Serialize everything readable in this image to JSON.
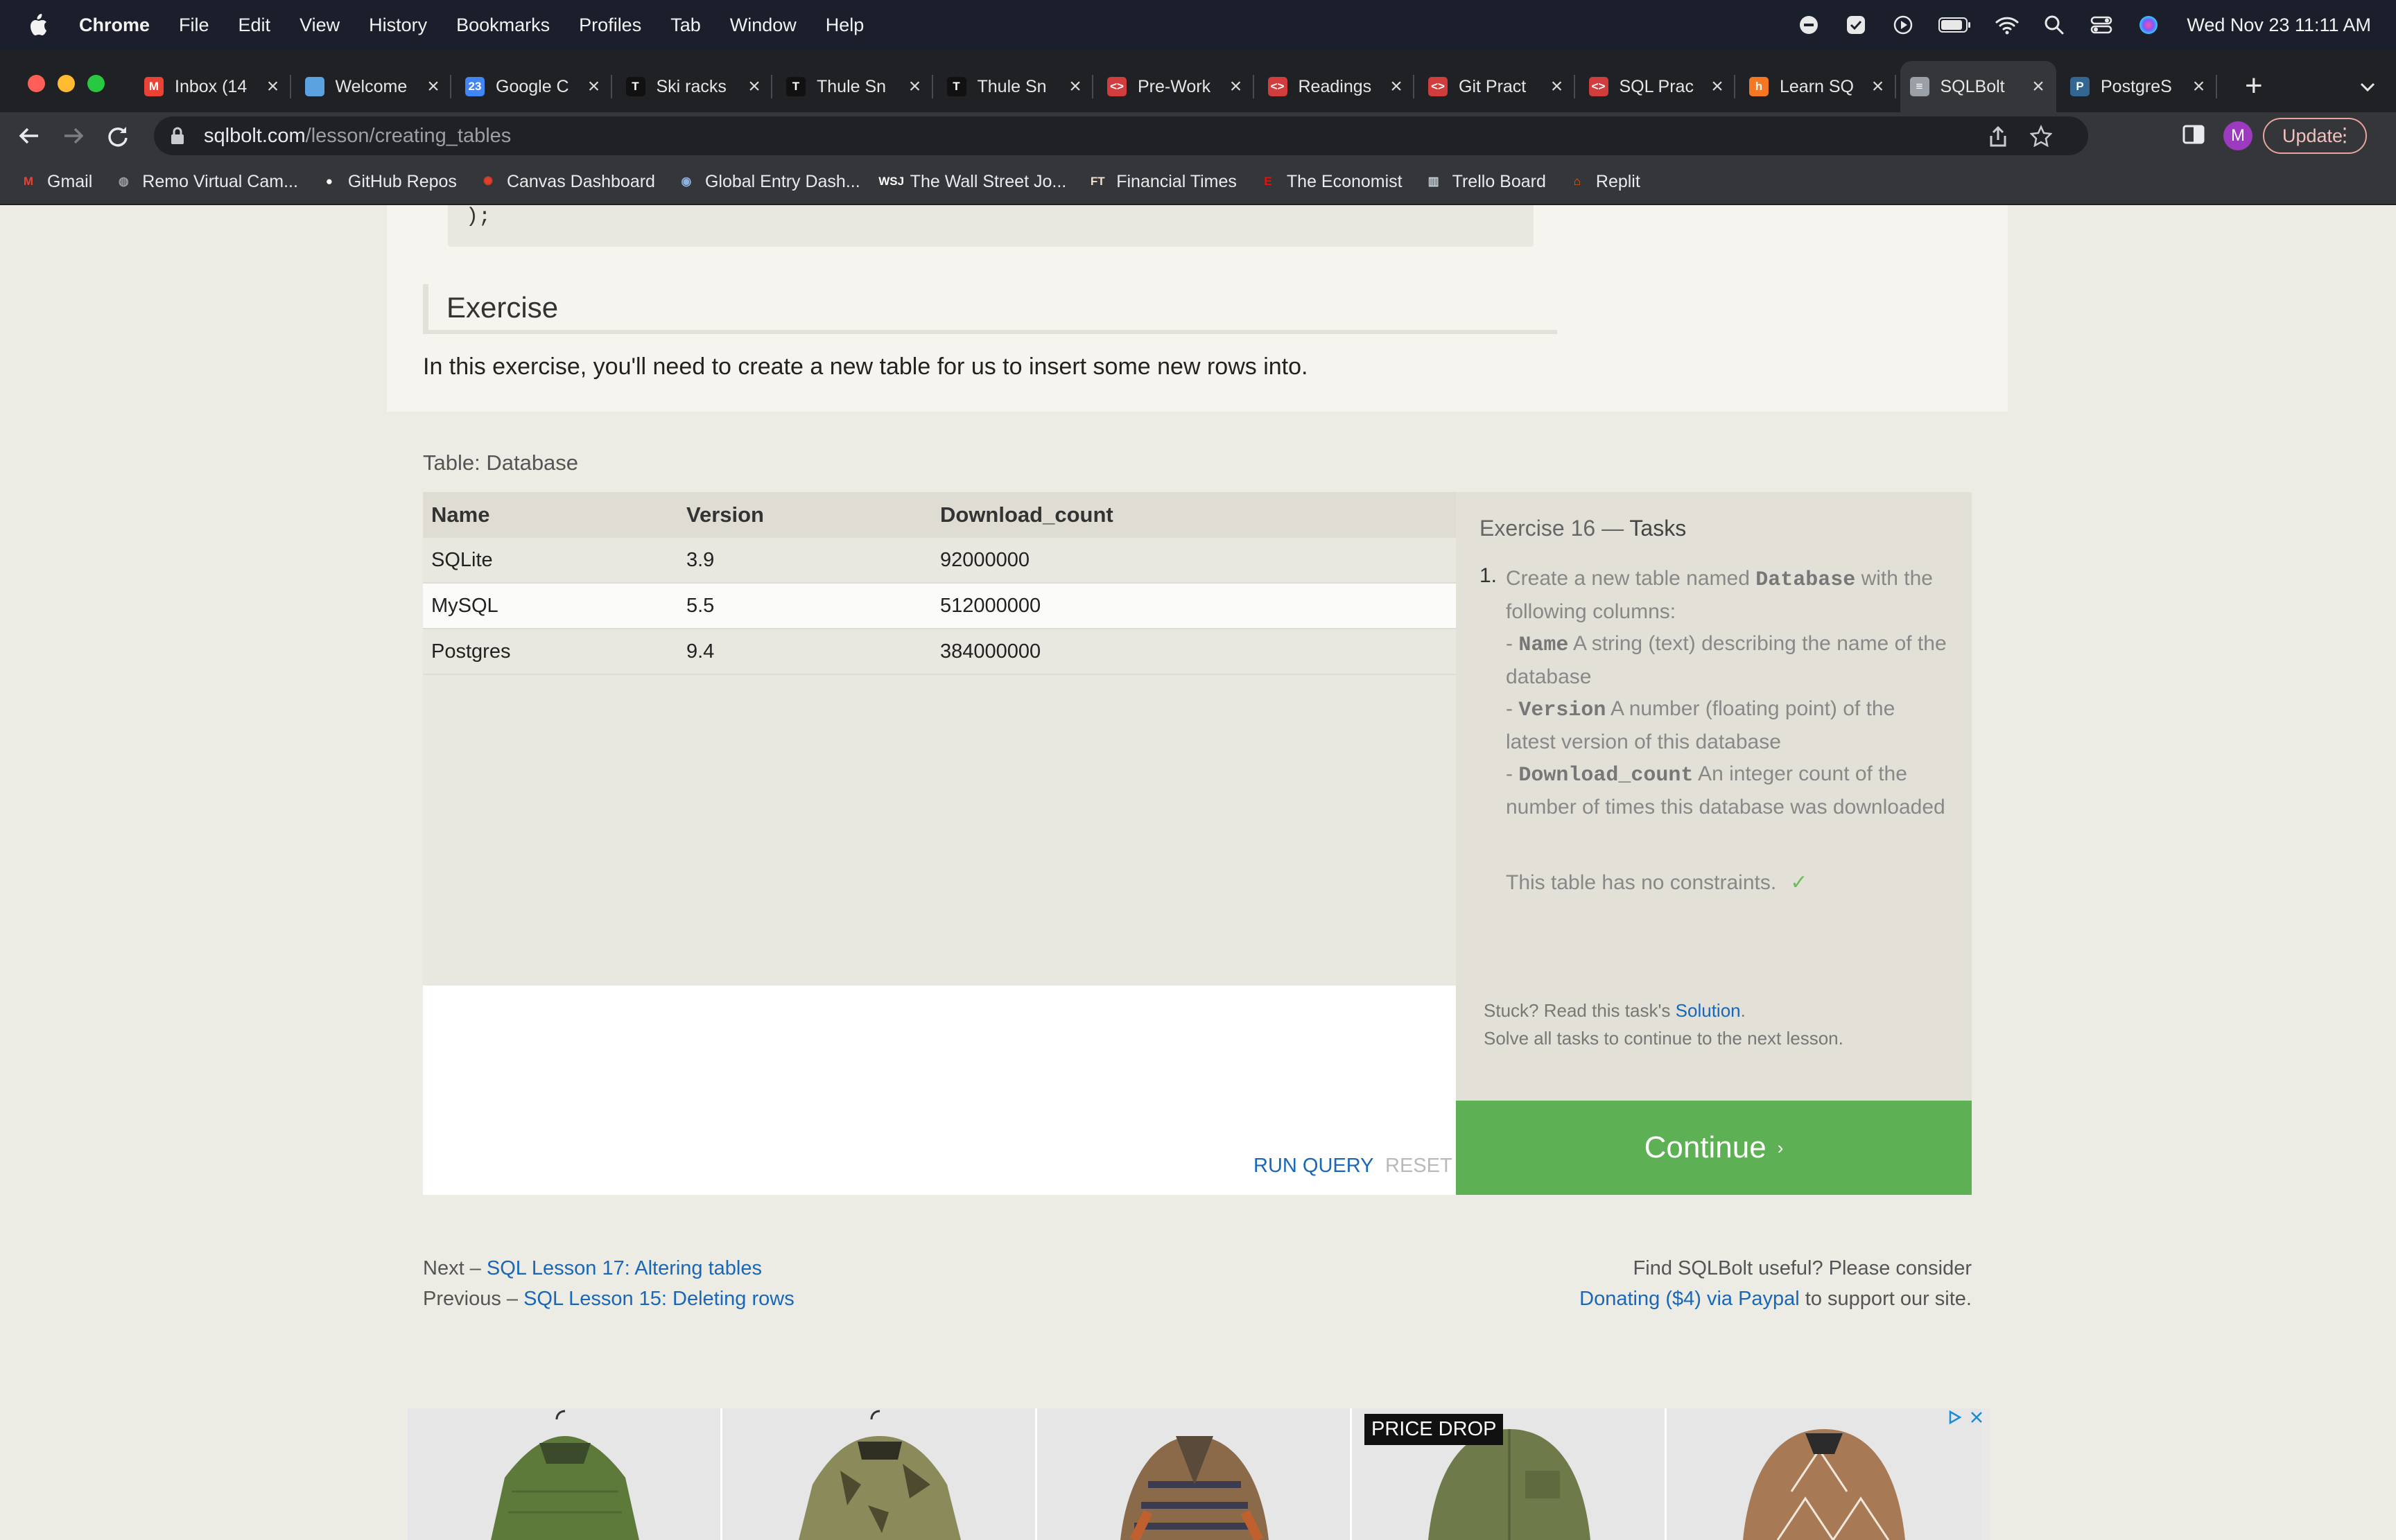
{
  "menubar": {
    "app": "Chrome",
    "items": [
      "File",
      "Edit",
      "View",
      "History",
      "Bookmarks",
      "Profiles",
      "Tab",
      "Window",
      "Help"
    ],
    "clock": "Wed Nov 23  11:11 AM"
  },
  "tabs": [
    {
      "label": "Inbox (14",
      "icon": "gmail-icon",
      "color": "#ea4335",
      "glyph": "M"
    },
    {
      "label": "Welcome",
      "icon": "page-icon",
      "color": "#5aa3e0",
      "glyph": ""
    },
    {
      "label": "Google C",
      "icon": "calendar-icon",
      "color": "#4285f4",
      "glyph": "23"
    },
    {
      "label": "Ski racks",
      "icon": "thule-icon",
      "color": "#111111",
      "glyph": "T"
    },
    {
      "label": "Thule Sn",
      "icon": "thule-icon",
      "color": "#111111",
      "glyph": "T"
    },
    {
      "label": "Thule Sn",
      "icon": "thule-icon",
      "color": "#111111",
      "glyph": "T"
    },
    {
      "label": "Pre-Work",
      "icon": "code-icon",
      "color": "#d13c3c",
      "glyph": "<>"
    },
    {
      "label": "Readings",
      "icon": "code-icon",
      "color": "#d13c3c",
      "glyph": "<>"
    },
    {
      "label": "Git Pract",
      "icon": "code-icon",
      "color": "#d13c3c",
      "glyph": "<>"
    },
    {
      "label": "SQL Prac",
      "icon": "code-icon",
      "color": "#d13c3c",
      "glyph": "<>"
    },
    {
      "label": "Learn SQ",
      "icon": "hubspot-icon",
      "color": "#f57722",
      "glyph": "h"
    },
    {
      "label": "SQLBolt",
      "icon": "database-icon",
      "color": "#9aa0a6",
      "glyph": "≡"
    },
    {
      "label": "PostgreS",
      "icon": "postgres-icon",
      "color": "#336791",
      "glyph": "P"
    }
  ],
  "address": {
    "host": "sqlbolt.com",
    "path": "/lesson/creating_tables"
  },
  "update_label": "Update",
  "profile_initial": "M",
  "bookmarks": [
    {
      "label": "Gmail",
      "icon": "gmail-icon",
      "color": "#ea4335",
      "glyph": "M"
    },
    {
      "label": "Remo Virtual Cam...",
      "icon": "globe-icon",
      "color": "#9aa0a6",
      "glyph": "◍"
    },
    {
      "label": "GitHub Repos",
      "icon": "github-icon",
      "color": "#ffffff",
      "glyph": "●"
    },
    {
      "label": "Canvas Dashboard",
      "icon": "canvas-icon",
      "color": "#e13f2b",
      "glyph": "✺"
    },
    {
      "label": "Global Entry Dash...",
      "icon": "dhs-seal-icon",
      "color": "#8fb3e0",
      "glyph": "◉"
    },
    {
      "label": "The Wall Street Jo...",
      "icon": "wsj-icon",
      "color": "#ffffff",
      "glyph": "WSJ"
    },
    {
      "label": "Financial Times",
      "icon": "ft-icon",
      "color": "#f2dfce",
      "glyph": "FT"
    },
    {
      "label": "The Economist",
      "icon": "economist-icon",
      "color": "#e3120b",
      "glyph": "E"
    },
    {
      "label": "Trello Board",
      "icon": "trello-icon",
      "color": "#c9d3dc",
      "glyph": "▥"
    },
    {
      "label": "Replit",
      "icon": "replit-icon",
      "color": "#f26207",
      "glyph": "⌂"
    }
  ],
  "lesson": {
    "code_tail": ");",
    "exercise_heading": "Exercise",
    "exercise_intro": "In this exercise, you'll need to create a new table for us to insert some new rows into.",
    "table_title": "Table: Database",
    "table": {
      "columns": [
        "Name",
        "Version",
        "Download_count"
      ],
      "rows": [
        [
          "SQLite",
          "3.9",
          "92000000"
        ],
        [
          "MySQL",
          "5.5",
          "512000000"
        ],
        [
          "Postgres",
          "9.4",
          "384000000"
        ]
      ]
    },
    "run_query": "RUN QUERY",
    "reset": "RESET",
    "tasks": {
      "heading_prefix": "Exercise 16 — ",
      "heading_bold": "Tasks",
      "number": "1.",
      "intro_a": "Create a new table named ",
      "intro_code": "Database",
      "intro_b": " with the following columns:",
      "col1_code": "Name",
      "col1_desc": " A string (text) describing the name of the database",
      "col2_code": "Version",
      "col2_desc": " A number (floating point) of the latest version of this database",
      "col3_code": "Download_count",
      "col3_desc": " An integer count of the number of times this database was downloaded",
      "dash": "- ",
      "constraint": "This table has no constraints.",
      "check": "✓",
      "stuck_a": "Stuck? Read this task's ",
      "stuck_link": "Solution",
      "stuck_b": ".",
      "stuck_line2": "Solve all tasks to continue to the next lesson."
    },
    "continue_label": "Continue",
    "continue_chevron": "›",
    "next_prefix": "Next – ",
    "next_link": "SQL Lesson 17: Altering tables",
    "prev_prefix": "Previous – ",
    "prev_link": "SQL Lesson 15: Deleting rows",
    "support_line1": "Find SQLBolt useful? Please consider",
    "support_link": "Donating ($4) via Paypal",
    "support_tail": " to support our site."
  },
  "ad": {
    "price_drop": "PRICE DROP"
  },
  "colors": {
    "accent_green": "#5db054",
    "link_blue": "#1a67b8"
  }
}
